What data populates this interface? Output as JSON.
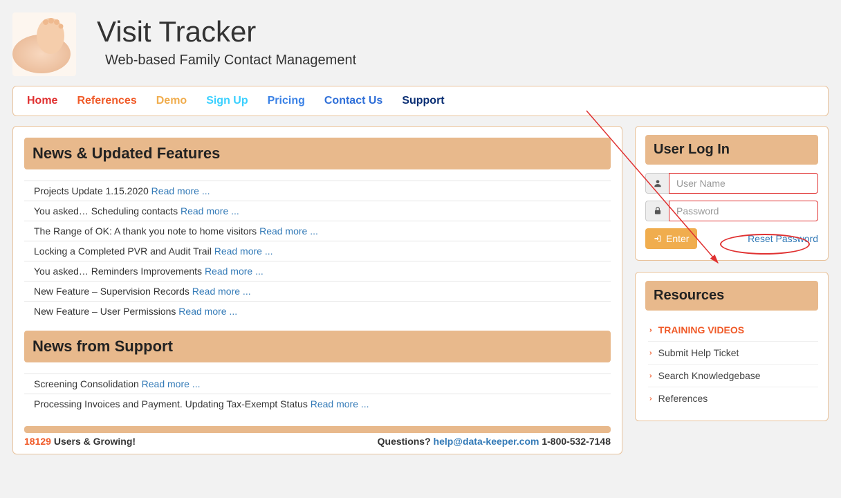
{
  "brand": {
    "title": "Visit Tracker",
    "subtitle": "Web-based Family Contact Management"
  },
  "nav": {
    "home": "Home",
    "references": "References",
    "demo": "Demo",
    "signup": "Sign Up",
    "pricing": "Pricing",
    "contact": "Contact Us",
    "support": "Support"
  },
  "sections": {
    "news_features": "News & Updated Features",
    "news_support": "News from Support",
    "user_login": "User Log In",
    "resources": "Resources"
  },
  "read_more": "Read more ...",
  "news_features": [
    "Projects Update 1.15.2020",
    "You asked… Scheduling contacts",
    "The Range of OK: A thank you note to home visitors",
    "Locking a Completed PVR and Audit Trail",
    "You asked… Reminders Improvements",
    "New Feature – Supervision Records",
    "New Feature – User Permissions"
  ],
  "news_support": [
    "Screening Consolidation",
    "Processing Invoices and Payment. Updating Tax-Exempt Status"
  ],
  "footer": {
    "users_count": "18129",
    "users_text": " Users & Growing!",
    "questions_label": "Questions? ",
    "email": "help@data-keeper.com",
    "phone": " 1-800-532-7148"
  },
  "login": {
    "username_placeholder": "User Name",
    "password_placeholder": "Password",
    "enter": "Enter",
    "reset": "Reset Password"
  },
  "resources": [
    "TRAINING VIDEOS",
    "Submit Help Ticket",
    "Search Knowledgebase",
    "References"
  ]
}
